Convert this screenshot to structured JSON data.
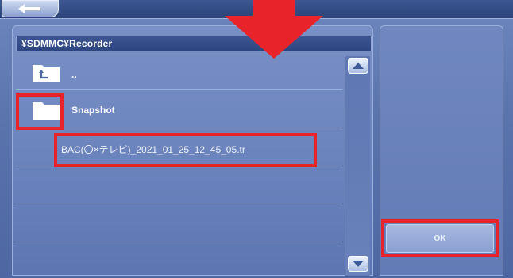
{
  "header": {
    "back_icon": "back-arrow-icon"
  },
  "browser": {
    "path": "¥SDMMC¥Recorder",
    "items": [
      {
        "label": "..",
        "icon": "parent-folder-icon"
      },
      {
        "label": "Snapshot",
        "icon": "folder-icon"
      },
      {
        "label": "BAC(〇×テレビ)_2021_01_25_12_45_05.tr",
        "icon": ""
      }
    ]
  },
  "scroll": {
    "up_icon": "scroll-up-icon",
    "down_icon": "scroll-down-icon"
  },
  "actions": {
    "ok_label": "OK"
  },
  "colors": {
    "highlight": "#e8232a",
    "panel": "#6a82bc",
    "bar": "#2d4580"
  }
}
